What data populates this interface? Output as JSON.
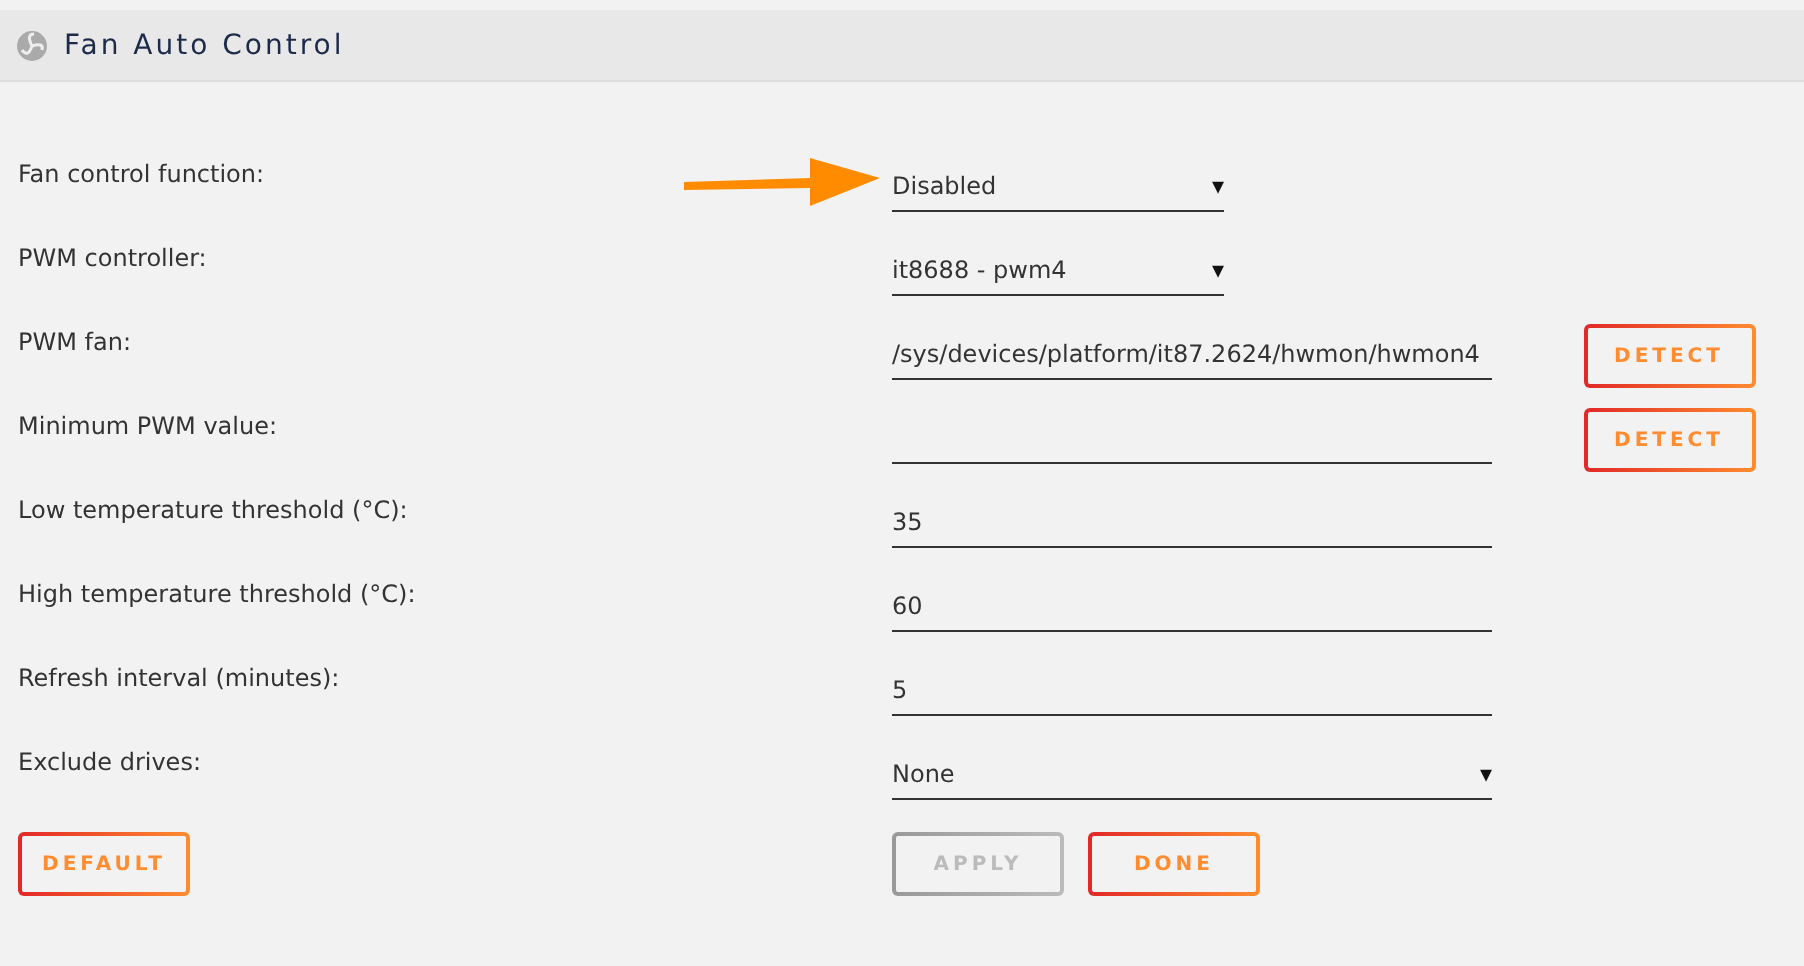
{
  "panel": {
    "title": "Fan Auto Control"
  },
  "fields": [
    {
      "label": "Fan control function:",
      "kind": "select",
      "value": "Disabled",
      "wide": false
    },
    {
      "label": "PWM controller:",
      "kind": "select",
      "value": "it8688 - pwm4",
      "wide": false
    },
    {
      "label": "PWM fan:",
      "kind": "input",
      "value": "/sys/devices/platform/it87.2624/hwmon/hwmon4",
      "wide": true,
      "action": "DETECT"
    },
    {
      "label": "Minimum PWM value:",
      "kind": "input",
      "wide": true,
      "action": "DETECT"
    },
    {
      "label": "Low temperature threshold (°C):",
      "kind": "input",
      "value": "35",
      "wide": true
    },
    {
      "label": "High temperature threshold (°C):",
      "kind": "input",
      "value": "60",
      "wide": true
    },
    {
      "label": "Refresh interval (minutes):",
      "kind": "input",
      "value": "5",
      "wide": true
    },
    {
      "label": "Exclude drives:",
      "kind": "select",
      "value": "None",
      "wide": true
    }
  ],
  "caret": "▾",
  "buttons": [
    {
      "label": "DEFAULT",
      "disabled": false
    },
    {
      "label": "APPLY",
      "disabled": true
    },
    {
      "label": "DONE",
      "disabled": false
    }
  ]
}
